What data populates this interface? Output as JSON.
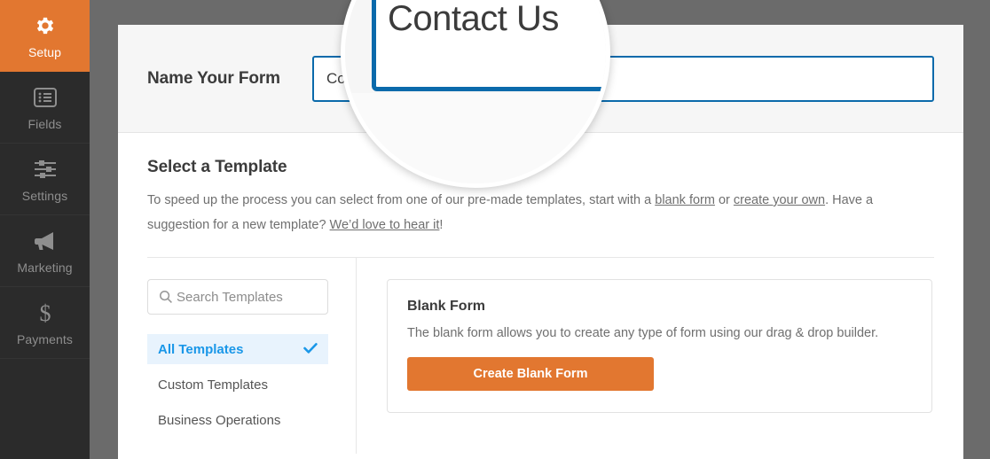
{
  "sidebar": {
    "items": [
      {
        "label": "Setup",
        "icon": "gear-icon",
        "active": true
      },
      {
        "label": "Fields",
        "icon": "list-icon",
        "active": false
      },
      {
        "label": "Settings",
        "icon": "sliders-icon",
        "active": false
      },
      {
        "label": "Marketing",
        "icon": "megaphone-icon",
        "active": false
      },
      {
        "label": "Payments",
        "icon": "dollar-icon",
        "active": false
      }
    ]
  },
  "header": {
    "name_label": "Name Your Form",
    "form_name_value": "Contact Us",
    "form_name_placeholder": ""
  },
  "template_section": {
    "title": "Select a Template",
    "desc_part1": "To speed up the process you can select from one of our pre-made templates, start with a ",
    "link_blank_form": "blank form",
    "desc_part2": " or ",
    "link_create_own": "create your own",
    "desc_part3": ". Have a suggestion for a new template? ",
    "link_hear_it": "We’d love to hear it",
    "desc_part4": "!"
  },
  "search": {
    "placeholder": "Search Templates",
    "value": "",
    "icon": "search-icon"
  },
  "categories": [
    {
      "label": "All Templates",
      "active": true,
      "check": "✔"
    },
    {
      "label": "Custom Templates",
      "active": false,
      "check": ""
    },
    {
      "label": "Business Operations",
      "active": false,
      "check": ""
    }
  ],
  "blank_form_card": {
    "title": "Blank Form",
    "description": "The blank form allows you to create any type of form using our drag & drop builder.",
    "button_label": "Create Blank Form"
  },
  "magnifier": {
    "zoom_text": "Contact Us"
  },
  "colors": {
    "accent_orange": "#e27730",
    "accent_blue": "#1a97e8",
    "input_border_blue": "#0b6aab",
    "sidebar_dark": "#2b2b2b",
    "page_backdrop": "#6b6b6b"
  }
}
